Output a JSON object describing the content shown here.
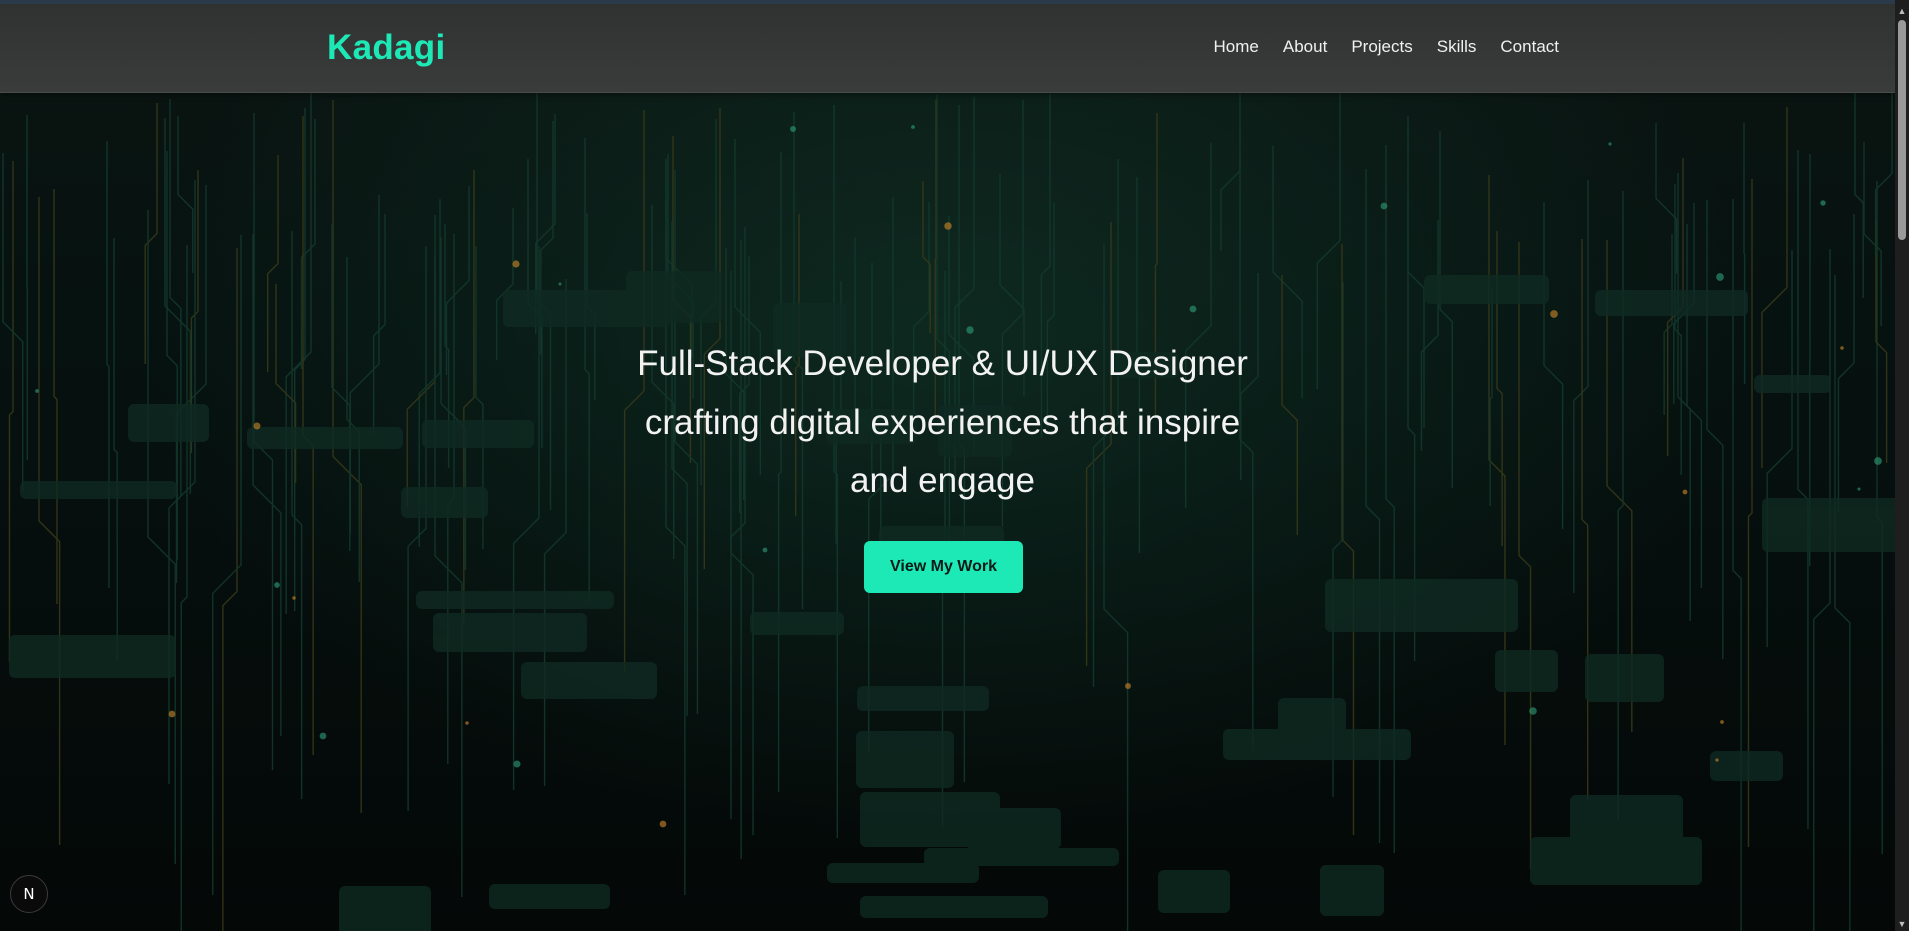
{
  "navbar": {
    "brand": "Kadagi",
    "links": [
      {
        "label": "Home"
      },
      {
        "label": "About"
      },
      {
        "label": "Projects"
      },
      {
        "label": "Skills"
      },
      {
        "label": "Contact"
      }
    ]
  },
  "hero": {
    "headline_lines": [
      "Full-Stack Developer & UI/UX Designer",
      "crafting digital experiences that inspire",
      "and engage"
    ],
    "cta_label": "View My Work"
  },
  "badge": {
    "letter": "N"
  },
  "scrollbar": {
    "up_icon": "▲",
    "down_icon": "▼"
  },
  "colors": {
    "accent": "#1de9b6",
    "navbar_bg": "#363838",
    "hero_bg": "#050807"
  }
}
